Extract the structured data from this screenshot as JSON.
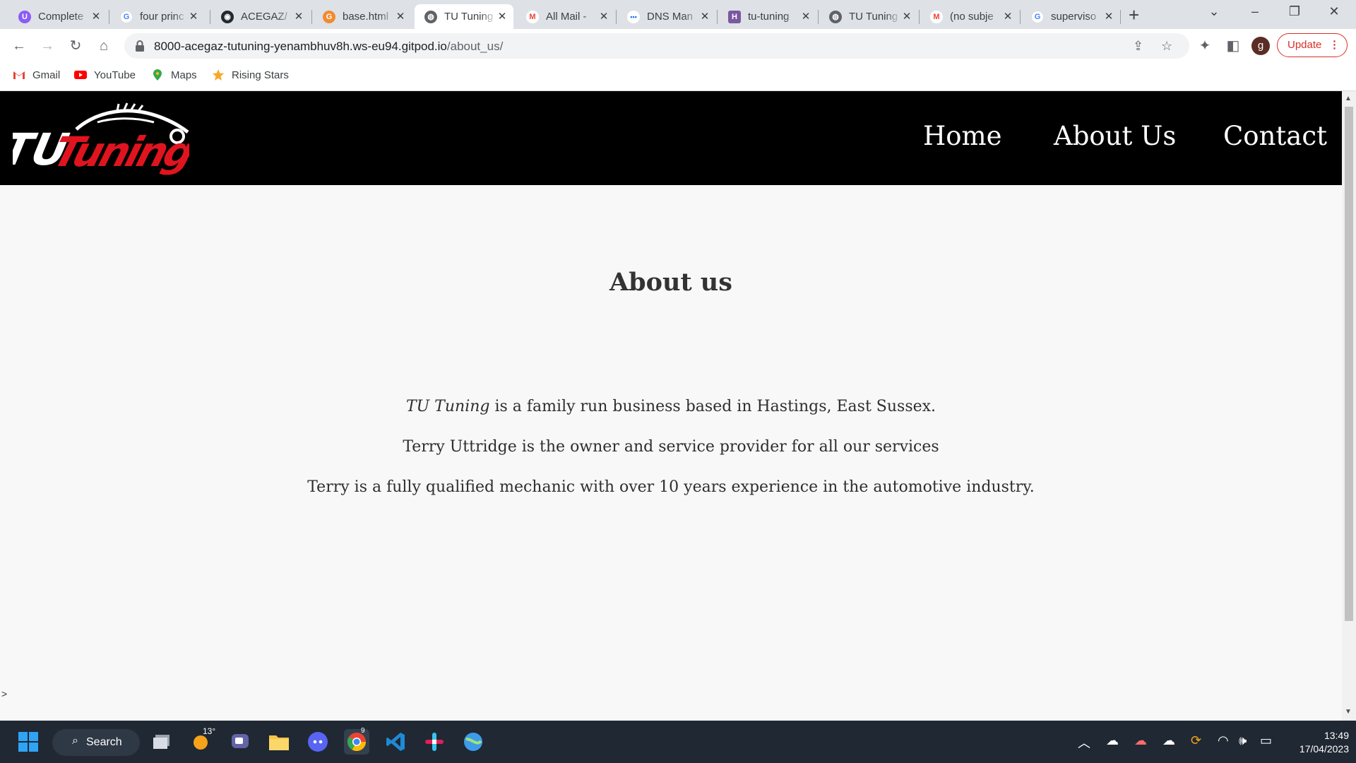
{
  "browser": {
    "tabs": [
      {
        "title": "Complete",
        "favicon": "purple-u-icon",
        "color": "#8a5cf6"
      },
      {
        "title": "four princ",
        "favicon": "google-icon",
        "color": "#4285f4"
      },
      {
        "title": "ACEGAZ/",
        "favicon": "github-icon",
        "color": "#24292e"
      },
      {
        "title": "base.html",
        "favicon": "orange-g-icon",
        "color": "#f28b30"
      },
      {
        "title": "TU Tuning",
        "favicon": "globe-icon",
        "color": "#5f6368",
        "active": true
      },
      {
        "title": "All Mail -",
        "favicon": "gmail-icon",
        "color": "#ea4335"
      },
      {
        "title": "DNS Man",
        "favicon": "dns-icon",
        "color": "#1a73e8"
      },
      {
        "title": "tu-tuning",
        "favicon": "heroku-icon",
        "color": "#79589f"
      },
      {
        "title": "TU Tuning",
        "favicon": "globe-icon",
        "color": "#5f6368"
      },
      {
        "title": "(no subje",
        "favicon": "gmail-icon",
        "color": "#ea4335"
      },
      {
        "title": "superviso",
        "favicon": "google-icon",
        "color": "#4285f4"
      }
    ],
    "url_host": "8000-acegaz-tutuning-yenambhuv8h.ws-eu94.gitpod.io",
    "url_path": "/about_us/",
    "avatar_letter": "g",
    "update_label": "Update",
    "bookmarks": [
      {
        "label": "Gmail",
        "icon": "gmail-icon"
      },
      {
        "label": "YouTube",
        "icon": "youtube-icon"
      },
      {
        "label": "Maps",
        "icon": "maps-icon"
      },
      {
        "label": "Rising Stars",
        "icon": "star-icon"
      }
    ]
  },
  "site": {
    "logo_text": "TU Tuning",
    "nav": [
      "Home",
      "About Us",
      "Contact"
    ],
    "title": "About us",
    "paragraph1_em": "TU Tuning",
    "paragraph1_rest": " is a family run business based in Hastings, East Sussex.",
    "paragraph2": "Terry Uttridge is the owner and service provider for all our services",
    "paragraph3": "Terry is a fully qualified mechanic with over 10 years experience in the automotive industry.",
    "console_caret": ">"
  },
  "taskbar": {
    "search_label": "Search",
    "weather_temp": "13°",
    "chrome_badge": "9",
    "time": "13:49",
    "date": "17/04/2023"
  }
}
